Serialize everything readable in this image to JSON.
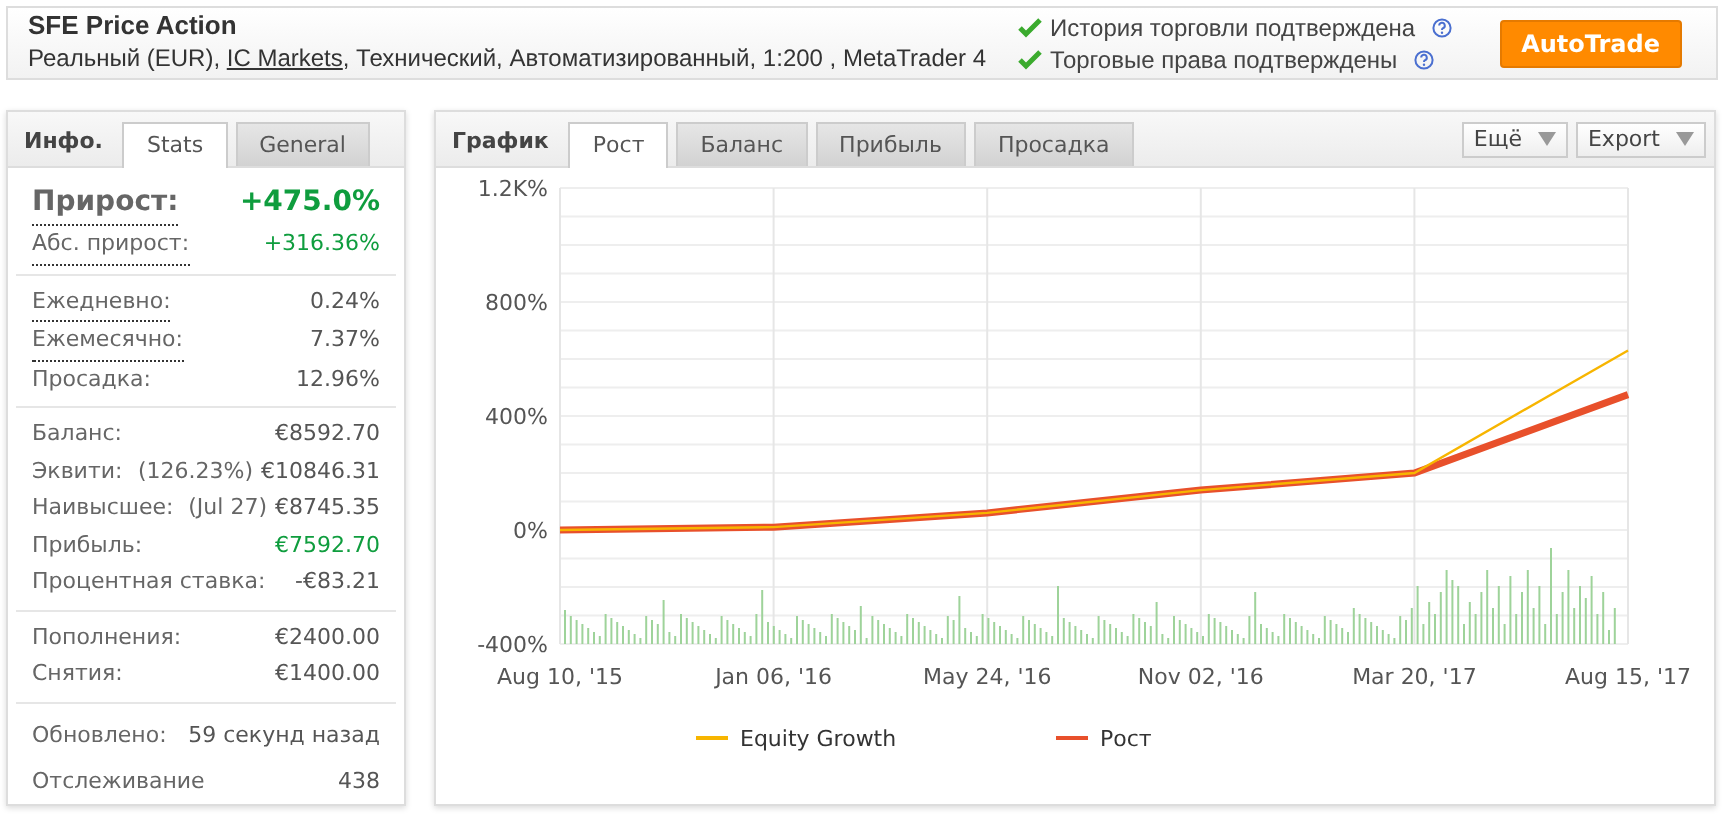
{
  "header": {
    "title": "SFE Price Action",
    "subtitle": {
      "before": "Реальный (EUR), ",
      "link": "IC Markets",
      "after": ", Технический, Автоматизированный, 1:200 , MetaTrader 4"
    },
    "verifications": [
      {
        "label": "История торговли подтверждена"
      },
      {
        "label": "Торговые права подтверждены"
      }
    ],
    "button": "AutoTrade"
  },
  "info": {
    "title": "Инфо.",
    "tabs": [
      {
        "label": "Stats",
        "selected": true
      },
      {
        "label": "General",
        "selected": false
      }
    ],
    "sections": [
      [
        {
          "kind": "headline",
          "label": "Прирост:",
          "value": "+475.0%",
          "color": "#0f9d3e",
          "dotted": true
        },
        {
          "kind": "row",
          "label": "Абс. прирост:",
          "value": "+316.36%",
          "color": "#0f9d3e",
          "dotted": true
        }
      ],
      [
        {
          "kind": "row",
          "label": "Ежедневно:",
          "value": "0.24%",
          "color": "#555555",
          "dotted": true
        },
        {
          "kind": "row",
          "label": "Ежемесячно:",
          "value": "7.37%",
          "color": "#555555",
          "dotted": true
        },
        {
          "kind": "row",
          "label": "Просадка:",
          "value": "12.96%",
          "color": "#555555",
          "dotted": false
        }
      ],
      [
        {
          "kind": "row",
          "label": "Баланс:",
          "value": "€8592.70",
          "color": "#555555",
          "dotted": false
        },
        {
          "kind": "row",
          "label": "Эквити:",
          "note": "(126.23%)",
          "value": "€10846.31",
          "color": "#555555",
          "dotted": false
        },
        {
          "kind": "row",
          "label": "Наивысшее:",
          "note": "(Jul 27)",
          "value": "€8745.35",
          "color": "#555555",
          "dotted": false
        },
        {
          "kind": "row",
          "label": "Прибыль:",
          "value": "€7592.70",
          "color": "#0f9d3e",
          "dotted": false
        },
        {
          "kind": "row",
          "label": "Процентная ставка:",
          "value": "-€83.21",
          "color": "#555555",
          "dotted": false
        }
      ],
      [
        {
          "kind": "row",
          "label": "Пополнения:",
          "value": "€2400.00",
          "color": "#555555",
          "dotted": false
        },
        {
          "kind": "row",
          "label": "Снятия:",
          "value": "€1400.00",
          "color": "#555555",
          "dotted": false
        }
      ],
      [
        {
          "kind": "tall",
          "label": "Обновлено:",
          "value": "59 секунд назад",
          "color": "#555555",
          "dotted": false
        },
        {
          "kind": "tall",
          "label": "Отслеживание",
          "value": "438",
          "color": "#555555",
          "dotted": false
        }
      ]
    ]
  },
  "chart_panel": {
    "title": "График",
    "tabs": [
      {
        "label": "Рост",
        "selected": true
      },
      {
        "label": "Баланс",
        "selected": false
      },
      {
        "label": "Прибыль",
        "selected": false
      },
      {
        "label": "Просадка",
        "selected": false
      }
    ],
    "menus": [
      "Ещё",
      "Export"
    ],
    "chart_data": {
      "type": "line",
      "categories": [
        "Aug 10, '15",
        "Jan 06, '16",
        "May 24, '16",
        "Nov 02, '16",
        "Mar 20, '17",
        "Aug 15, '17"
      ],
      "ylim": [
        -400,
        1200
      ],
      "grid": true,
      "legend": true,
      "yticks": [
        {
          "value": 1200,
          "label": "1.2K%"
        },
        {
          "value": 800,
          "label": "800%"
        },
        {
          "value": 400,
          "label": "400%"
        },
        {
          "value": 0,
          "label": "0%"
        },
        {
          "value": -400,
          "label": "-400%"
        }
      ],
      "series": [
        {
          "name": "Equity Growth",
          "color": "#f7b500",
          "values": [
            0,
            10,
            60,
            140,
            200,
            630
          ]
        },
        {
          "name": "Рост",
          "color": "#e8502b",
          "values": [
            0,
            10,
            60,
            140,
            200,
            475
          ]
        }
      ]
    }
  }
}
